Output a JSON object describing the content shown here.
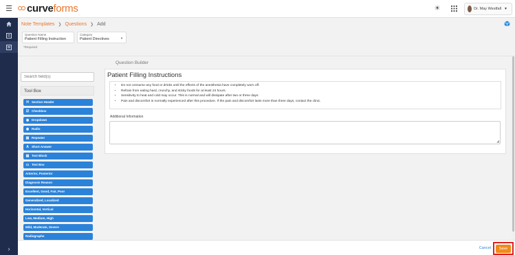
{
  "brand": {
    "name_bold": "curve",
    "name_light": "forms"
  },
  "header": {
    "user_name": "Dr. May Westfall"
  },
  "breadcrumb": {
    "items": [
      "Note Templates",
      "Questions"
    ],
    "current": "Add"
  },
  "form": {
    "question_name_label": "Question Name",
    "question_name_value": "Patient Filling Instruction",
    "category_label": "Category",
    "category_value": "Patient Directives",
    "required_note": "*Required"
  },
  "left_panel": {
    "search_placeholder": "Search field(s)",
    "toolbox_title": "Tool Box",
    "tools": [
      {
        "label": "Section Header",
        "icon": "heading-icon"
      },
      {
        "label": "Checkbox",
        "icon": "checkbox-icon"
      },
      {
        "label": "Dropdown",
        "icon": "dropdown-icon"
      },
      {
        "label": "Radio",
        "icon": "radio-icon"
      },
      {
        "label": "Repeater",
        "icon": "repeater-icon"
      },
      {
        "label": "Short Answer",
        "icon": "short-answer-icon"
      },
      {
        "label": "Text Block",
        "icon": "text-block-icon"
      },
      {
        "label": "Text Box",
        "icon": "text-box-icon"
      },
      {
        "label": "Anterior, Posterior"
      },
      {
        "label": "Diagnosis Reason"
      },
      {
        "label": "Excellent, Good, Fair, Poor"
      },
      {
        "label": "Generalized, Localized"
      },
      {
        "label": "Horizontal, Vertical"
      },
      {
        "label": "Low, Medium, High"
      },
      {
        "label": "Mild, Moderate, Severe"
      },
      {
        "label": "Radiographs"
      }
    ]
  },
  "builder": {
    "label": "Question Builder",
    "title": "Patient Filling Instructions",
    "instructions": [
      "Do not consume any food or drinks until the effects of the anesthesia have completely worn off.",
      "Refrain from eating hard, crunchy, and sticky foods for at least 24 hours.",
      "Sensitivity to heat and cold may occur. This is normal and will dissipate after two or three days.",
      "Pain and discomfort is normally experienced after this procedure. If the pain and discomfort lasts more than three days, contact the clinic."
    ],
    "additional_label": "Additional Information"
  },
  "footer": {
    "cancel_label": "Cancel",
    "save_label": "Save"
  },
  "colors": {
    "accent": "#e8762c",
    "primary": "#2b82d9",
    "sidebar": "#1f2c4c",
    "save": "#f18a1c",
    "highlight": "#e02020"
  }
}
